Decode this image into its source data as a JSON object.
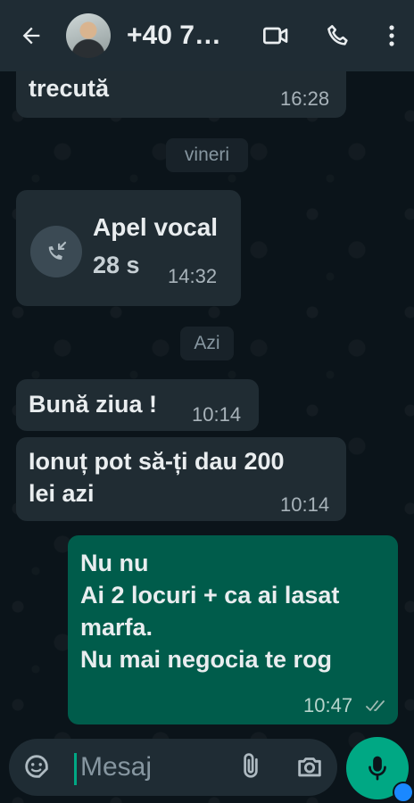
{
  "header": {
    "contact_name": "+40 7…",
    "icons": [
      "back-arrow-icon",
      "video-call-icon",
      "phone-call-icon",
      "more-vertical-icon"
    ]
  },
  "messages": [
    {
      "direction": "in",
      "text": "trecută",
      "time": "16:28"
    },
    {
      "type": "date",
      "text": "vineri"
    },
    {
      "direction": "in",
      "type": "call",
      "title": "Apel vocal",
      "duration": "28 s",
      "time": "14:32",
      "icon": "missed-call-arrow-icon"
    },
    {
      "type": "date",
      "text": "Azi"
    },
    {
      "direction": "in",
      "text": "Bună ziua !",
      "time": "10:14"
    },
    {
      "direction": "in",
      "text_lines": [
        "Ionuț pot să-ți dau 200",
        "lei azi"
      ],
      "time": "10:14"
    },
    {
      "direction": "out",
      "text_lines": [
        "Nu nu",
        "Ai 2 locuri + ca ai lasat",
        "marfa.",
        "Nu mai negocia te rog"
      ],
      "time": "10:47",
      "status": "read"
    }
  ],
  "composer": {
    "placeholder": "Mesaj",
    "icons": [
      "sticker-icon",
      "attach-icon",
      "camera-icon",
      "mic-icon"
    ]
  },
  "colors": {
    "background": "#0b141a",
    "header": "#1f2c34",
    "incoming_bubble": "#202c33",
    "outgoing_bubble": "#005c4b",
    "accent": "#00a884"
  }
}
